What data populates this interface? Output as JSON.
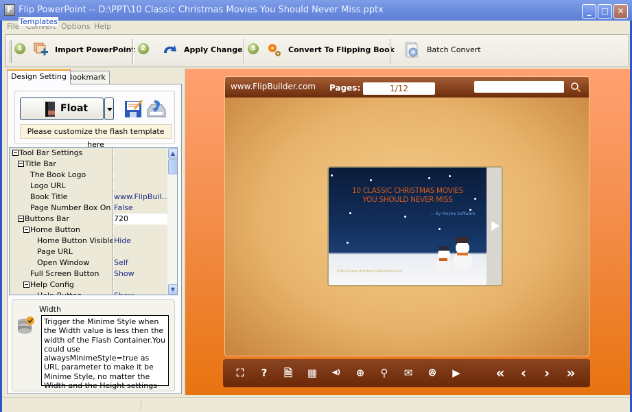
{
  "window": {
    "title": "Flip PowerPoint -- D:\\PPT\\10 Classic Christmas Movies You Should Never Miss.pptx",
    "app_icon_letter": "F",
    "controls": {
      "minimize": "_",
      "maximize": "□",
      "close": "✕"
    }
  },
  "menu": [
    "File",
    "Convert",
    "Options",
    "Help"
  ],
  "toolbar": {
    "steps": [
      "1",
      "2",
      "3"
    ],
    "import_label": "Import PowerPoint",
    "apply_label": "Apply Change",
    "convert_label": "Convert To Flipping Book",
    "batch_label": "Batch Convert"
  },
  "left_panel": {
    "tabs": [
      "Design Setting",
      "Bookmark"
    ],
    "active_tab": "Design Setting",
    "templates_label": "Templates",
    "template_name": "Float",
    "template_hint": "Please customize the flash template here",
    "properties": [
      {
        "key": "Tool Bar Settings",
        "value": "",
        "level": 0,
        "expander": true
      },
      {
        "key": "Title Bar",
        "value": "",
        "level": 1,
        "expander": true
      },
      {
        "key": "The Book Logo",
        "value": "",
        "level": 2,
        "expander": false
      },
      {
        "key": "Logo URL",
        "value": "",
        "level": 2,
        "expander": false
      },
      {
        "key": "Book Title",
        "value": "www.FlipBuil...",
        "level": 2,
        "expander": false
      },
      {
        "key": "Page Number Box On ...",
        "value": "False",
        "level": 2,
        "expander": false
      },
      {
        "key": "Buttons Bar",
        "value": "720",
        "level": 1,
        "expander": true,
        "editing": true
      },
      {
        "key": "Home Button",
        "value": "",
        "level": 2,
        "expander": true
      },
      {
        "key": "Home Button Visible",
        "value": "Hide",
        "level": 3,
        "expander": false
      },
      {
        "key": "Page URL",
        "value": "",
        "level": 3,
        "expander": false
      },
      {
        "key": "Open Window",
        "value": "Self",
        "level": 3,
        "expander": false
      },
      {
        "key": "Full Screen Button",
        "value": "Show",
        "level": 2,
        "expander": false
      },
      {
        "key": "Help Config",
        "value": "",
        "level": 2,
        "expander": true
      },
      {
        "key": "Help Button",
        "value": "Show",
        "level": 3,
        "expander": false
      }
    ],
    "description": {
      "title": "Width",
      "text": "Trigger the Minime Style when the Width value is less then the width of the Flash Container.You could use alwaysMinimeStyle=true as URL parameter to make it be Minime Style, no matter the Width and the Height settings"
    }
  },
  "preview": {
    "site": "www.FlipBuilder.com",
    "pages_label": "Pages:",
    "page_value": "1/12",
    "search_value": "",
    "slide": {
      "title_line1": "10 CLASSIC CHRISTMAS MOVIES",
      "title_line2": "YOU SHOULD NEVER MISS",
      "byline": "— By Moyea Software",
      "url": "http://www.dvd-ppt-slideshow.com"
    },
    "bottom_buttons": [
      {
        "name": "fullscreen-button",
        "icon": "⛶"
      },
      {
        "name": "help-button",
        "icon": "?"
      },
      {
        "name": "print-button",
        "icon": "🗎"
      },
      {
        "name": "thumbnails-button",
        "icon": "▦"
      },
      {
        "name": "sound-button",
        "icon": "◀)"
      },
      {
        "name": "zoom-in-button",
        "icon": "⊕"
      },
      {
        "name": "search-button",
        "icon": "⚲"
      },
      {
        "name": "email-button",
        "icon": "✉"
      },
      {
        "name": "share-button",
        "icon": "ꔮ"
      },
      {
        "name": "autoplay-button",
        "icon": "▶"
      },
      {
        "name": "first-page-button",
        "icon": "«"
      },
      {
        "name": "prev-page-button",
        "icon": "‹"
      },
      {
        "name": "next-page-button",
        "icon": "›"
      },
      {
        "name": "last-page-button",
        "icon": "»"
      }
    ]
  },
  "colors": {
    "accent_orange": "#e87410",
    "bar_brown": "#6b2806",
    "title_blue": "#6f8fe0",
    "property_value_blue": "#1a2a8a"
  }
}
